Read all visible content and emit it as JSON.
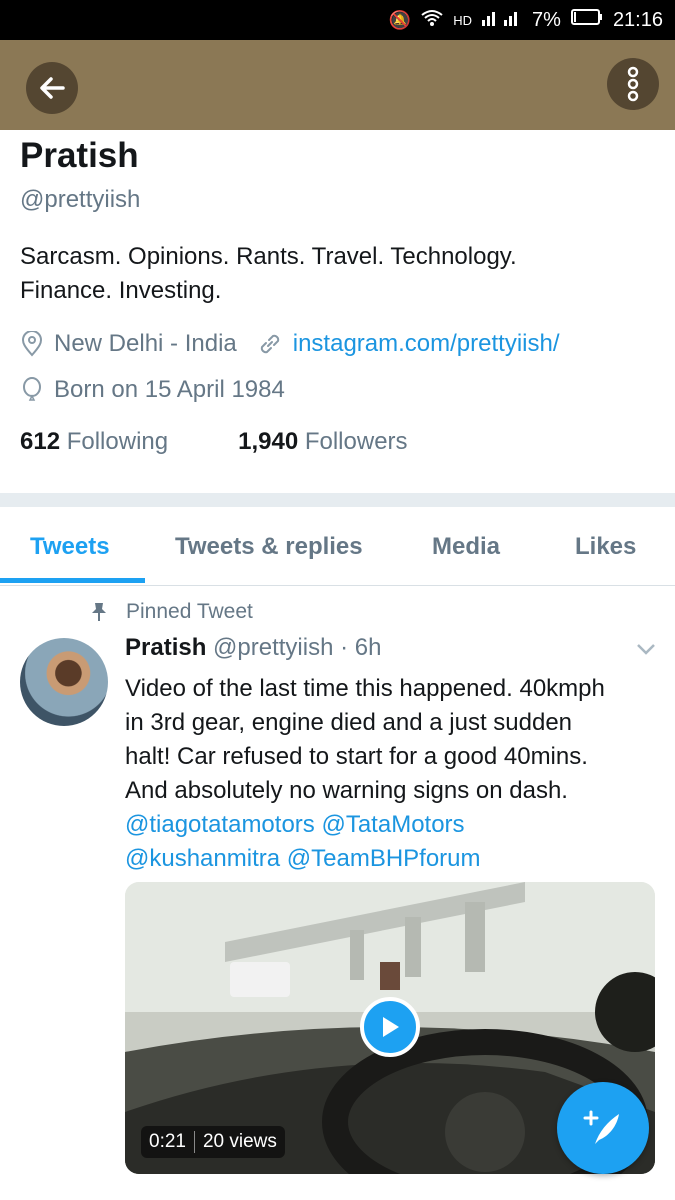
{
  "status_bar": {
    "signal_text": "HD",
    "battery": "7%",
    "time": "21:16"
  },
  "profile": {
    "name": "Pratish",
    "handle": "@prettyiish",
    "bio_line1": "Sarcasm. Opinions. Rants. Travel. Technology.",
    "bio_line2": "Finance. Investing.",
    "location": "New Delhi - India",
    "website": "instagram.com/prettyiish/",
    "birthday": "Born on 15 April 1984",
    "following_count": "612",
    "following_label": "Following",
    "followers_count": "1,940",
    "followers_label": "Followers"
  },
  "tabs": [
    {
      "label": "Tweets"
    },
    {
      "label": "Tweets & replies"
    },
    {
      "label": "Media"
    },
    {
      "label": "Likes"
    }
  ],
  "tweet": {
    "pinned_label": "Pinned Tweet",
    "author_name": "Pratish",
    "author_handle": "@prettyiish",
    "time": "· 6h",
    "text_line1": "Video of the last time this happened. 40kmph",
    "text_line2": "in 3rd gear, engine died and a just sudden",
    "text_line3": "halt! Car refused to start for a good 40mins.",
    "text_line4": "And absolutely no warning signs on dash.",
    "mention1": "@tiagotatamotors",
    "mention2": "@TataMotors",
    "mention3": "@kushanmitra",
    "mention4": "@TeamBHPforum",
    "video_duration": "0:21",
    "video_views": "20 views"
  },
  "colors": {
    "accent": "#1da1f2",
    "header": "#8b7855"
  }
}
